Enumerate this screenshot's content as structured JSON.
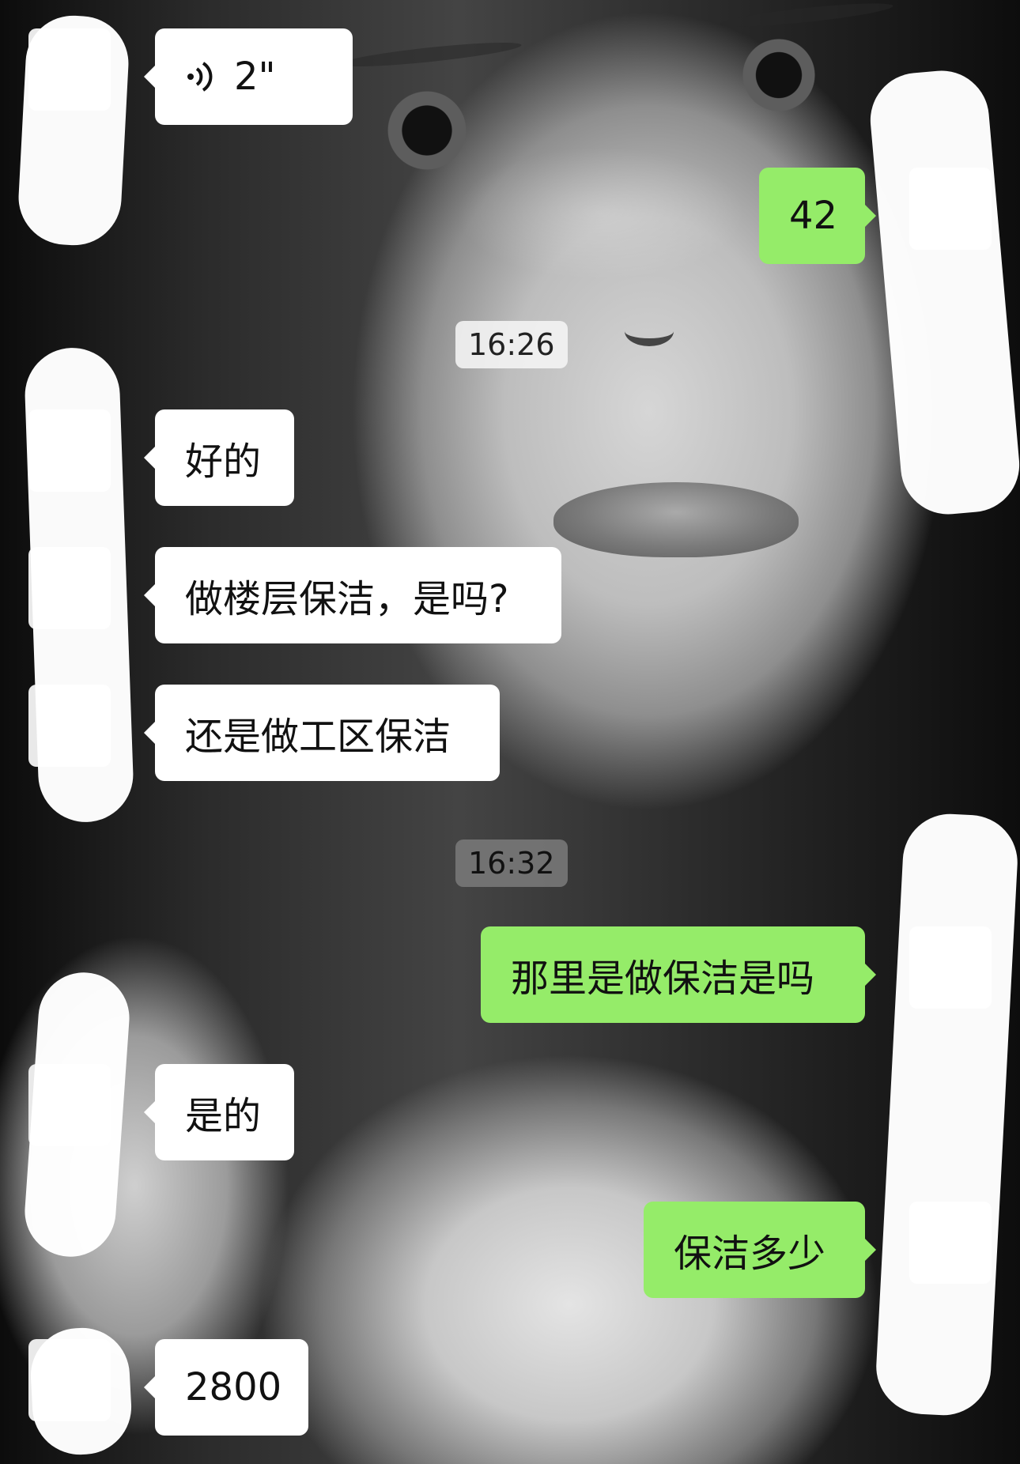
{
  "chat": {
    "messages": [
      {
        "side": "in",
        "type": "voice",
        "duration": "2\""
      },
      {
        "side": "out",
        "text": "42"
      },
      {
        "type": "time",
        "text": "16:26"
      },
      {
        "side": "in",
        "text": "好的"
      },
      {
        "side": "in",
        "text": "做楼层保洁，是吗?"
      },
      {
        "side": "in",
        "text": "还是做工区保洁"
      },
      {
        "type": "time",
        "text": "16:32"
      },
      {
        "side": "out",
        "text": "那里是做保洁是吗"
      },
      {
        "side": "in",
        "text": "是的"
      },
      {
        "side": "out",
        "text": "保洁多少"
      },
      {
        "side": "in",
        "text": "2800"
      }
    ]
  },
  "icons": {
    "voice": "voice-wave-icon"
  },
  "colors": {
    "incoming_bubble": "#ffffff",
    "outgoing_bubble": "#95ec69",
    "timestamp_light": "#f5f5f5",
    "timestamp_dark": "#787878"
  }
}
